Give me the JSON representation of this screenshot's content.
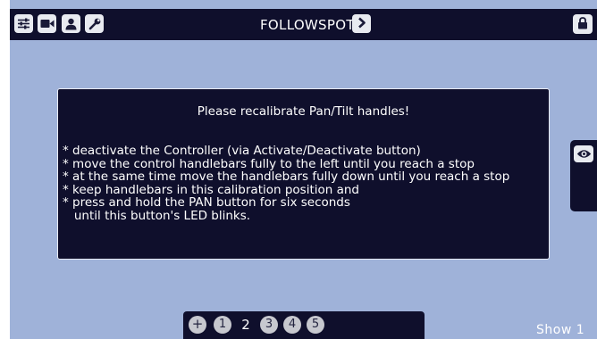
{
  "topbar": {
    "icons": [
      "sliders-icon",
      "camera-icon",
      "user-icon",
      "wrench-icon"
    ],
    "title": "FOLLOWSPOT",
    "next_icon": "chevron-right-icon",
    "lock_icon": "lock-icon"
  },
  "dialog": {
    "title": "Please recalibrate Pan/Tilt handles!",
    "message": "* deactivate the Controller (via Activate/Deactivate button)\n* move the control handlebars fully to the left until you reach a stop\n* at the same time move the handlebars fully down until you reach a stop\n* keep handlebars in this calibration position and\n* press and hold the PAN button for six seconds\n   until this button's LED blinks."
  },
  "side_panel": {
    "icon": "eye-icon"
  },
  "pager": {
    "add_label": "+",
    "pages": [
      "1",
      "2",
      "3",
      "4",
      "5"
    ],
    "current": "2"
  },
  "footer": {
    "show_label": "Show 1"
  },
  "colors": {
    "background": "#9fb2d9",
    "panel": "#0f0f2c",
    "button": "#e8eaf0"
  }
}
